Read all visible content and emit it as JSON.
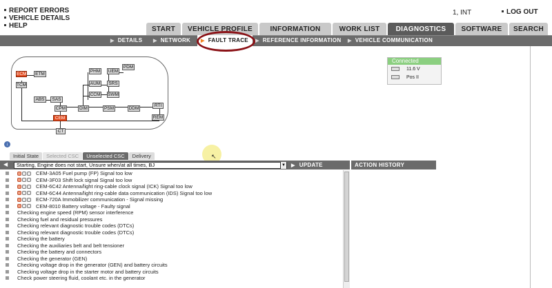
{
  "top_links": [
    "REPORT ERRORS",
    "VEHICLE DETAILS",
    "HELP"
  ],
  "user": "1, INT",
  "logout": "LOG OUT",
  "main_tabs": [
    "START",
    "VEHICLE PROFILE",
    "INFORMATION",
    "WORK LIST",
    "DIAGNOSTICS",
    "SOFTWARE",
    "SEARCH"
  ],
  "sub_nav": [
    "DETAILS",
    "NETWORK",
    "FAULT TRACE",
    "REFERENCE INFORMATION",
    "VEHICLE COMMUNICATION"
  ],
  "modules": {
    "ecm": "ECM",
    "etm": "ETM",
    "tcm": "TCM",
    "phm": "PHM",
    "pdm": "PDM",
    "uem": "UEM",
    "aum": "AUM",
    "srs": "SRS",
    "ccm": "CCM",
    "swm": "SWM",
    "abs": "ABS",
    "sas": "SAS",
    "cpm": "CPM",
    "dim": "DIM",
    "psm": "PSM",
    "ddm": "DDM",
    "rti": "RTI",
    "rem": "REM",
    "cem": "CEM",
    "ct": "CT"
  },
  "connection": {
    "status": "Connected",
    "voltage": "11.6 V",
    "key_position": "Pos II"
  },
  "lower_tabs": [
    "Initial State",
    "Selected CSC",
    "Unselected CSC",
    "Delivery"
  ],
  "filter": {
    "selected": "Starting, Engine does not start, Unsure when/at all times, BJ",
    "update": "UPDATE"
  },
  "action_history": "ACTION HISTORY",
  "dtcs": [
    "CEM-3A05 Fuel pump (FP) Signal too low",
    "CEM-3F03 Shift lock signal Signal too low",
    "CEM-6C42 Antenna/light ring-cable clock signal (ICK) Signal too low",
    "CEM-6C44 Antenna/light ring-cable data communication (IDS) Signal too low",
    "ECM-720A Immobilizer communication - Signal missing",
    "CEM-8010 Battery voltage - Faulty signal"
  ],
  "checks": [
    "Checking engine speed (RPM) sensor interference",
    "Checking fuel and residual pressures",
    "Checking relevant diagnostic trouble codes (DTCs)",
    "Checking relevant diagnostic trouble codes (DTCs)",
    "Checking the battery",
    "Checking the auxiliaries belt and belt tensioner",
    "Checking the battery and connectors",
    "Checking the generator (GEN)",
    "Checking voltage drop in the generator (GEN) and battery circuits",
    "Checking voltage drop in the starter motor and battery circuits",
    "Check power steering fluid, coolant etc. in the generator"
  ]
}
